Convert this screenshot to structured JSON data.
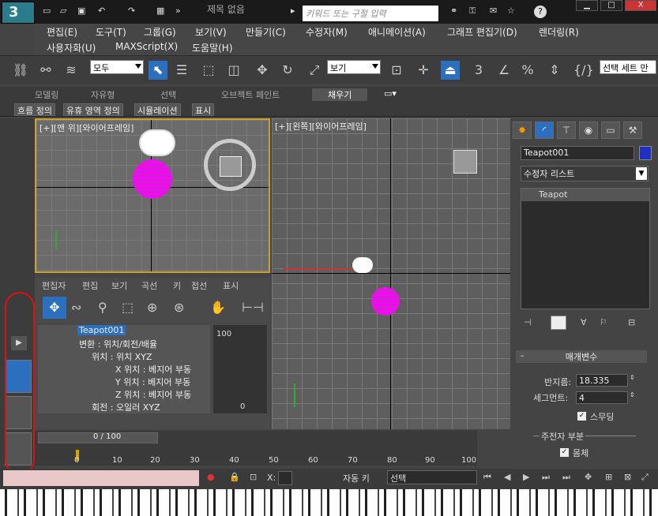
{
  "titlebar": {
    "title": "제목 없음",
    "search_placeholder": "키워드 또는 구절 입력",
    "min": "▁",
    "max": "□",
    "close": "X",
    "help": "?"
  },
  "menu": [
    "편집(E)",
    "도구(T)",
    "그룹(G)",
    "보기(V)",
    "만들기(C)",
    "수정자(M)",
    "애니메이션(A)",
    "그래프 편집기(D)",
    "렌더링(R)",
    "사용자화(U)",
    "MAXScript(X)",
    "도움말(H)"
  ],
  "toolbar": {
    "selection_filter": "모두",
    "refcoord": "보기",
    "named_sel": "선택 세트 만"
  },
  "ribbon": {
    "tabs": [
      "모델링",
      "자유형",
      "선택",
      "오브젝트 페인트",
      "채우기"
    ],
    "subtabs": [
      "흐름 정의",
      "유휴 영역 정의",
      "시뮬레이션",
      "표시"
    ]
  },
  "viewports": {
    "top": "[+][맨 위][와이어프레임]",
    "left": "[+][왼쪽][와이어프레임]"
  },
  "curve_editor": {
    "menus": [
      "편집자",
      "편집",
      "보기",
      "곡선",
      "키",
      "접선",
      "표시"
    ],
    "tree": [
      "Teapot001",
      "변환 : 위치/회전/배율",
      "위치 : 위치 XYZ",
      "X 위치 : 베지어 부동",
      "Y 위치 : 베지어 부동",
      "Z 위치 : 베지어 부동",
      "회전 : 오일러 XYZ"
    ],
    "scale_top": "100",
    "scale_bottom": "0"
  },
  "timeline": {
    "frame": "0 / 100",
    "ticks": [
      "0",
      "10",
      "20",
      "30",
      "40",
      "50",
      "60",
      "70",
      "80",
      "90",
      "100"
    ]
  },
  "status": {
    "x_label": "X:",
    "autokey": "자동 키",
    "selection": "선택"
  },
  "panel": {
    "object_name": "Teapot001",
    "modifier_list": "수정자 리스트",
    "stack_item": "Teapot",
    "params_title": "매개변수",
    "radius_label": "반지름:",
    "radius_value": "18.335",
    "segments_label": "세그먼트:",
    "segments_value": "4",
    "smooth_label": "스무딩",
    "parts_label": "주전자 부분",
    "body_label": "몸체"
  },
  "colors": {
    "accent": "#2a7b8c",
    "selection": "#c030c0",
    "highlight": "#2c6fbe"
  }
}
